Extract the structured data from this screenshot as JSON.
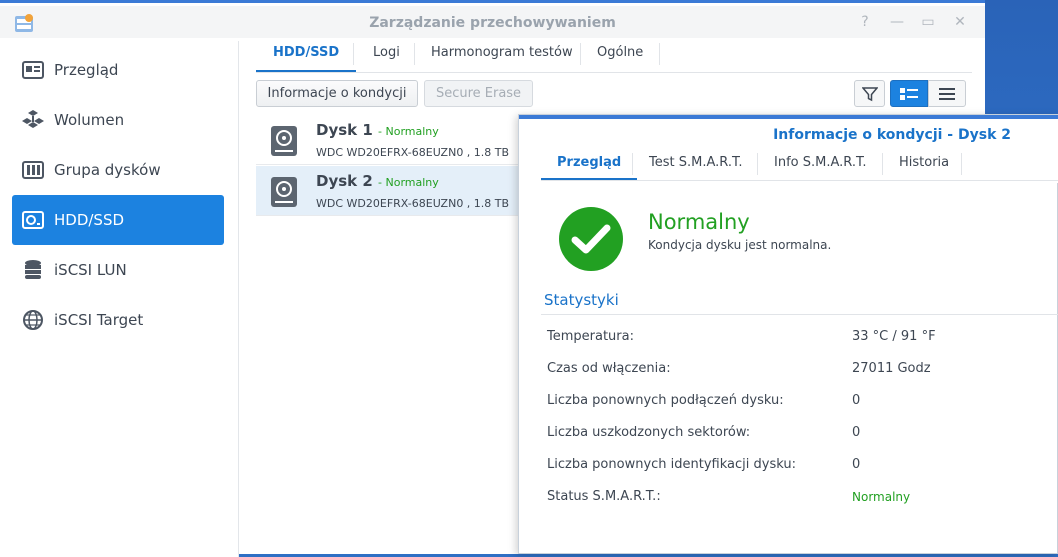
{
  "window": {
    "title": "Zarządzanie przechowywaniem",
    "help_glyph": "?",
    "min_glyph": "—",
    "max_glyph": "▭",
    "close_glyph": "✕"
  },
  "sidebar": {
    "items": [
      {
        "label": "Przegląd",
        "icon": "overview-icon"
      },
      {
        "label": "Wolumen",
        "icon": "volume-icon"
      },
      {
        "label": "Grupa dysków",
        "icon": "disk-group-icon"
      },
      {
        "label": "HDD/SSD",
        "icon": "hdd-icon",
        "active": true
      },
      {
        "label": "iSCSI LUN",
        "icon": "database-icon"
      },
      {
        "label": "iSCSI Target",
        "icon": "globe-icon"
      }
    ]
  },
  "tabs": [
    "HDD/SSD",
    "Logi",
    "Harmonogram testów",
    "Ogólne"
  ],
  "toolbar": {
    "health_info": "Informacje o kondycji",
    "secure_erase": "Secure Erase"
  },
  "disks": [
    {
      "name": "Dysk 1",
      "status": "- Normalny",
      "model": "WDC WD20EFRX-68EUZN0 , 1.8 TB"
    },
    {
      "name": "Dysk 2",
      "status": "- Normalny",
      "model": "WDC WD20EFRX-68EUZN0 , 1.8 TB"
    }
  ],
  "detail": {
    "title": "Informacje o kondycji - Dysk 2",
    "tabs": [
      "Przegląd",
      "Test S.M.A.R.T.",
      "Info S.M.A.R.T.",
      "Historia"
    ],
    "status_title": "Normalny",
    "status_desc": "Kondycja dysku jest normalna.",
    "stats_heading": "Statystyki",
    "stats": [
      {
        "label": "Temperatura:",
        "value": "33 °C / 91 °F"
      },
      {
        "label": "Czas od włączenia:",
        "value": "27011 Godz"
      },
      {
        "label": "Liczba ponownych podłączeń dysku:",
        "value": "0"
      },
      {
        "label": "Liczba uszkodzonych sektorów:",
        "value": "0"
      },
      {
        "label": "Liczba ponownych identyfikacji dysku:",
        "value": "0"
      },
      {
        "label": "Status S.M.A.R.T.:",
        "value": "Normalny"
      }
    ]
  },
  "colors": {
    "accent": "#1c82e0",
    "ok": "#22a022"
  }
}
